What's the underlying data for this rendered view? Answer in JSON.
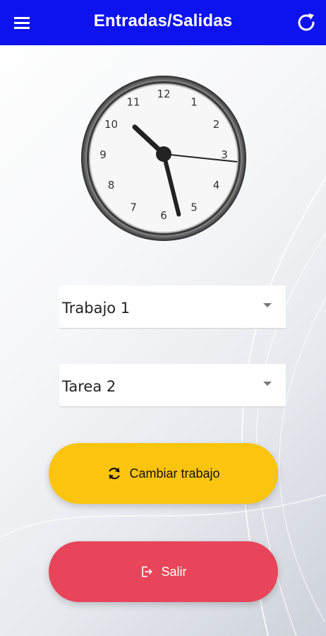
{
  "app_bar": {
    "title": "Entradas/Salidas",
    "menu_icon": "hamburger-menu-icon",
    "refresh_icon": "refresh-icon",
    "color": "#0d12ee"
  },
  "clock": {
    "numbers": [
      "12",
      "1",
      "2",
      "3",
      "4",
      "5",
      "6",
      "7",
      "8",
      "9",
      "10",
      "11"
    ],
    "time": {
      "hour": 10,
      "minute": 26,
      "second": 16
    }
  },
  "selectors": {
    "job": {
      "value": "Trabajo 1"
    },
    "task": {
      "value": "Tarea 2"
    }
  },
  "buttons": {
    "change_job": {
      "label": "Cambiar trabajo",
      "icon": "sync-icon",
      "color": "#fbc40e"
    },
    "exit": {
      "label": "Salir",
      "icon": "logout-icon",
      "color": "#e8455a"
    }
  }
}
